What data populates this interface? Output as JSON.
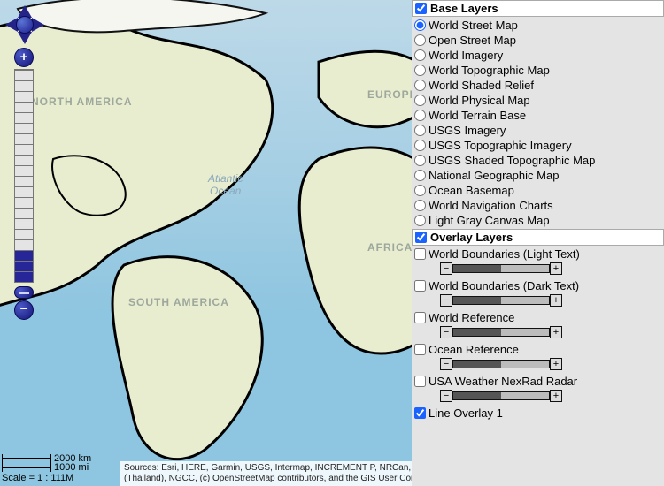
{
  "map": {
    "ocean_label": "Atlantic\nOcean",
    "continents": [
      "NORTH AMERICA",
      "SOUTH AMERICA",
      "EUROPE",
      "AFRICA"
    ]
  },
  "scale": {
    "km": "2000 km",
    "mi": "1000 mi",
    "ratio": "Scale = 1 : 111M"
  },
  "attribution": "Sources: Esri, HERE, Garmin, USGS, Intermap, INCREMENT P, NRCan, Esri Japan, METI, Esri China (Hong Kong), Esri Korea, Esri (Thailand), NGCC, (c) OpenStreetMap contributors, and the GIS User Community",
  "zoom": {
    "level": 3,
    "steps": 20
  },
  "panel": {
    "base_header": "Base Layers",
    "overlay_header": "Overlay Layers",
    "base_checked": true,
    "overlay_checked": true,
    "base_selected_index": 0,
    "base_items": [
      "World Street Map",
      "Open Street Map",
      "World Imagery",
      "World Topographic Map",
      "World Shaded Relief",
      "World Physical Map",
      "World Terrain Base",
      "USGS Imagery",
      "USGS Topographic Imagery",
      "USGS Shaded Topographic Map",
      "National Geographic Map",
      "Ocean Basemap",
      "World Navigation Charts",
      "Light Gray Canvas Map"
    ],
    "overlay_items": [
      {
        "label": "World Boundaries (Light Text)",
        "checked": false,
        "has_opacity": true,
        "opacity": 0.5,
        "disclose": true
      },
      {
        "label": "World Boundaries (Dark Text)",
        "checked": false,
        "has_opacity": true,
        "opacity": 0.5
      },
      {
        "label": "World Reference",
        "checked": false,
        "has_opacity": true,
        "opacity": 0.5
      },
      {
        "label": "Ocean Reference",
        "checked": false,
        "has_opacity": true,
        "opacity": 0.5
      },
      {
        "label": "USA Weather NexRad Radar",
        "checked": false,
        "has_opacity": true,
        "opacity": 0.5
      },
      {
        "label": "Line Overlay 1",
        "checked": true,
        "has_opacity": false
      }
    ]
  }
}
